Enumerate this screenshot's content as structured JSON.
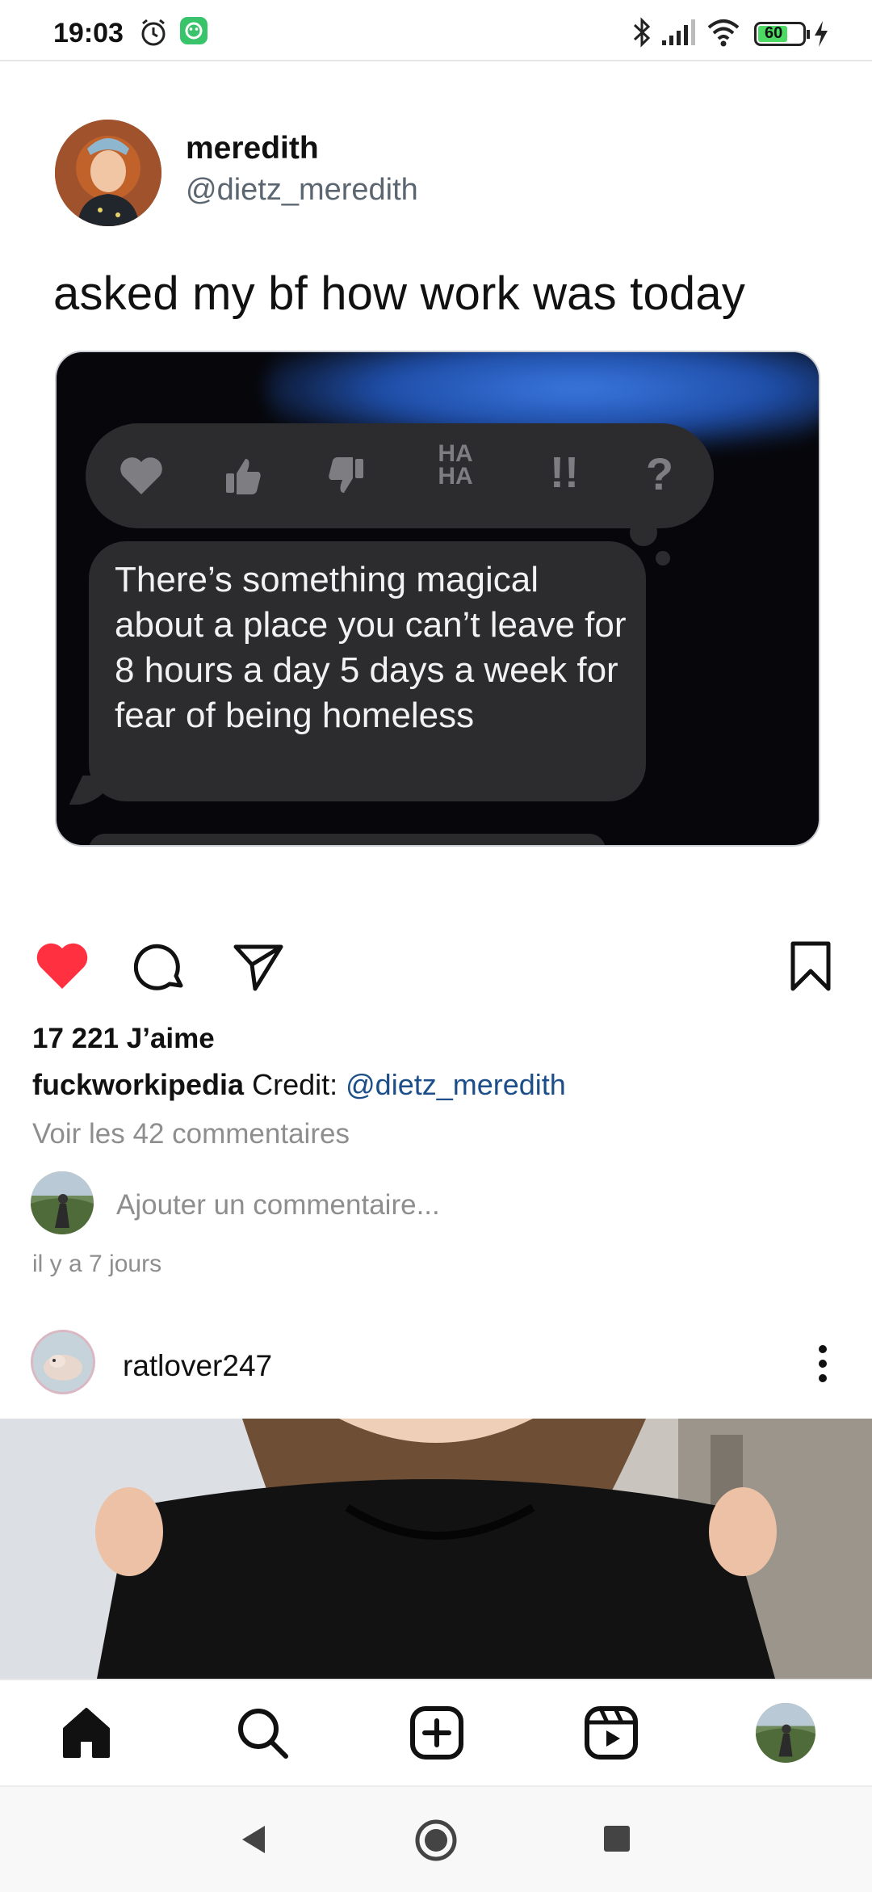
{
  "status_bar": {
    "time": "19:03",
    "battery": "60"
  },
  "tweet": {
    "name": "meredith",
    "handle": "@dietz_meredith",
    "text": "asked my bf how work was today",
    "media": {
      "reactions": [
        "heart-icon",
        "thumbs-up-icon",
        "thumbs-down-icon",
        "HA HA",
        "!!",
        "?"
      ],
      "reaction_haha": "HA",
      "reaction_haha2": "HA",
      "reaction_exclaim": "!!",
      "reaction_question": "?",
      "message": "There’s something magical about a place you can’t leave for 8 hours a day 5 days a week for fear of being homeless"
    }
  },
  "post": {
    "liked": true,
    "likes": "17 221 J’aime",
    "caption_user": "fuckworkipedia",
    "caption_text": "Credit: ",
    "caption_mention": "@dietz_meredith",
    "view_comments": "Voir les 42 commentaires",
    "add_comment_placeholder": "Ajouter un commentaire...",
    "time_ago": "il y a 7 jours"
  },
  "next_post": {
    "username": "ratlover247"
  },
  "bottom_nav": [
    "home-icon",
    "search-icon",
    "create-icon",
    "reels-icon",
    "profile-avatar"
  ],
  "colors": {
    "like_red": "#ff3040",
    "mention_blue": "#1c4f8a",
    "battery_green": "#4cd964"
  }
}
